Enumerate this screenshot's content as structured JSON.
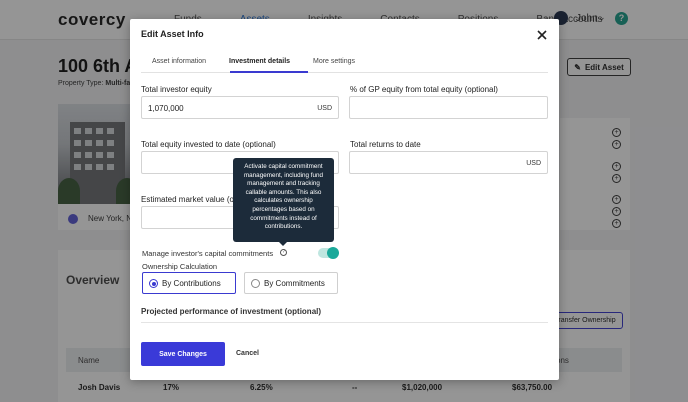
{
  "app": {
    "logo": "covercy",
    "nav": [
      "Funds",
      "Assets",
      "Insights",
      "Contacts",
      "Positions",
      "Bank Accounts"
    ],
    "active_nav": "Assets",
    "user_name": "John",
    "help": "?"
  },
  "property": {
    "title": "100 6th Av",
    "type_label": "Property Type:",
    "type_value": "Multi-fam",
    "edit_button": "Edit Asset",
    "location": "New York, N"
  },
  "overview": {
    "tab": "Overview",
    "transfer_button": "Transfer Ownership",
    "col_name": "Name",
    "col_distributions": "tions",
    "row": {
      "name": "Josh Davis",
      "pct1": "17%",
      "pct2": "6.25%",
      "dash": "--",
      "amount1": "$1,020,000",
      "amount2": "$63,750.00"
    }
  },
  "modal": {
    "title": "Edit Asset Info",
    "tabs": [
      "Asset information",
      "Investment details",
      "More settings"
    ],
    "active_tab": "Investment details",
    "fields": {
      "total_investor_equity": {
        "label": "Total investor equity",
        "value": "1,070,000",
        "unit": "USD"
      },
      "gp_equity_pct": {
        "label": "% of GP equity from total equity (optional)",
        "value": ""
      },
      "equity_invested": {
        "label": "Total equity invested to date (optional)",
        "value": ""
      },
      "total_returns": {
        "label": "Total returns to date",
        "value": "",
        "unit": "USD"
      },
      "market_value": {
        "label": "Estimated market value (op",
        "value": ""
      }
    },
    "tooltip": "Activate capital commitment management, including fund management and tracking callable amounts. This also calculates ownership percentages based on commitments instead of contributions.",
    "manage_label": "Manage investor's capital commitments",
    "toggle_on": true,
    "ownership_label": "Ownership Calculation",
    "radio_contrib": "By Contributions",
    "radio_commit": "By Commitments",
    "projected_label": "Projected performance of investment (optional)",
    "save_button": "Save Changes",
    "cancel_button": "Cancel"
  },
  "colors": {
    "accent": "#3a3ad8",
    "toggle": "#1aa99a",
    "tooltip_bg": "#1c2b3a"
  }
}
